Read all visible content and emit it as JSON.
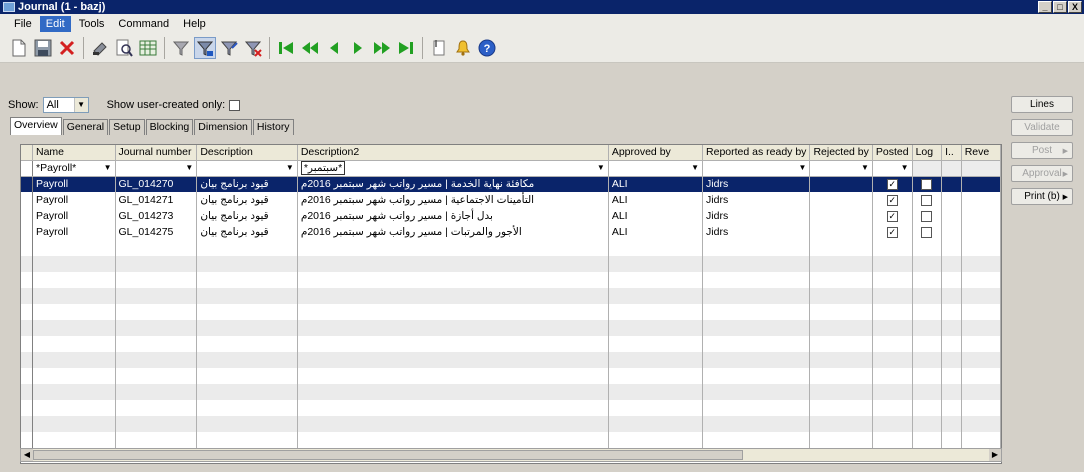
{
  "window": {
    "title": "Journal (1 - bazj)",
    "controls": [
      "_",
      "□",
      "X"
    ]
  },
  "menu": [
    {
      "label": "File",
      "active": false
    },
    {
      "label": "Edit",
      "active": true
    },
    {
      "label": "Tools",
      "active": false
    },
    {
      "label": "Command",
      "active": false
    },
    {
      "label": "Help",
      "active": false
    }
  ],
  "toolbar": {
    "icons": [
      "new-icon",
      "save-icon",
      "delete-icon",
      "refresh-icon",
      "print-preview-icon",
      "export-excel-icon",
      "filter-icon",
      "filter-by-selection-icon",
      "advanced-filter-icon",
      "remove-filter-icon",
      "first-record-icon",
      "previous-page-icon",
      "previous-record-icon",
      "next-record-icon",
      "next-page-icon",
      "last-record-icon",
      "attach-document-icon",
      "alert-icon",
      "help-icon"
    ]
  },
  "show": {
    "label": "Show:",
    "value": "All",
    "user_created_label": "Show user-created only:",
    "user_created_checked": false
  },
  "tabs": [
    "Overview",
    "General",
    "Setup",
    "Blocking",
    "Dimension",
    "History"
  ],
  "grid": {
    "columns": [
      "Name",
      "Journal number",
      "Description",
      "Description2",
      "Approved by",
      "Reported as ready by",
      "Rejected by",
      "Posted",
      "Log",
      "I..",
      "Reve"
    ],
    "filters": [
      "*Payroll*",
      "",
      "",
      "*سبتمبر*",
      "",
      "",
      "",
      "",
      "",
      "",
      ""
    ],
    "rows": [
      {
        "name": "Payroll",
        "journal": "GL_014270",
        "description": "قيود برنامج بيان",
        "description2": "مكافئة نهاية الخدمة | مسير رواتب شهر سبتمبر 2016م",
        "approved": "ALI",
        "reported": "Jidrs",
        "rejected": "",
        "posted": true,
        "log": false
      },
      {
        "name": "Payroll",
        "journal": "GL_014271",
        "description": "قيود برنامج بيان",
        "description2": "التأمينات الاجتماعية | مسير رواتب شهر سبتمبر 2016م",
        "approved": "ALI",
        "reported": "Jidrs",
        "rejected": "",
        "posted": true,
        "log": false
      },
      {
        "name": "Payroll",
        "journal": "GL_014273",
        "description": "قيود برنامج بيان",
        "description2": "بدل أجازة | مسير رواتب شهر سبتمبر 2016م",
        "approved": "ALI",
        "reported": "Jidrs",
        "rejected": "",
        "posted": true,
        "log": false
      },
      {
        "name": "Payroll",
        "journal": "GL_014275",
        "description": "قيود برنامج بيان",
        "description2": "الأجور والمرتبات | مسير رواتب شهر سبتمبر 2016م",
        "approved": "ALI",
        "reported": "Jidrs",
        "rejected": "",
        "posted": true,
        "log": false
      }
    ],
    "selected_row": 0
  },
  "sidebar": [
    {
      "label": "Lines",
      "enabled": true,
      "menu": false
    },
    {
      "label": "Validate",
      "enabled": false,
      "menu": false
    },
    {
      "label": "Post",
      "enabled": false,
      "menu": true
    },
    {
      "label": "Approval",
      "enabled": false,
      "menu": true
    },
    {
      "label": "Print (b)",
      "enabled": true,
      "menu": true
    }
  ]
}
